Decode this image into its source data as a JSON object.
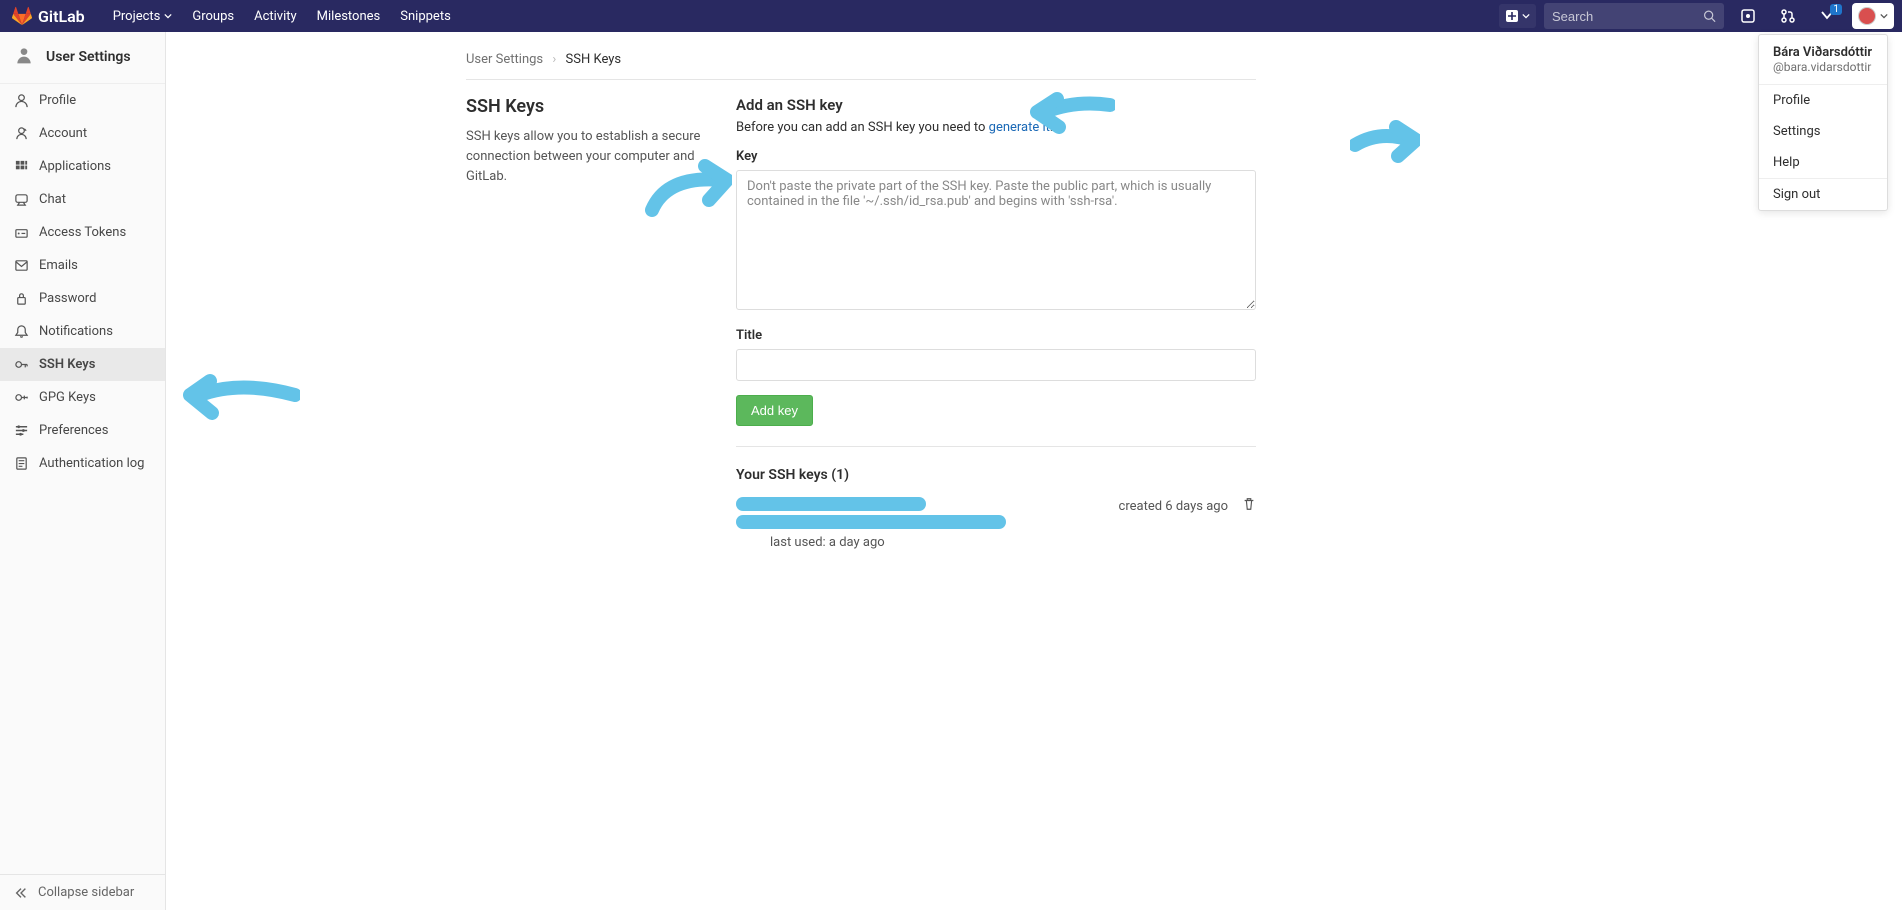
{
  "navbar": {
    "brand": "GitLab",
    "links": [
      "Projects",
      "Groups",
      "Activity",
      "Milestones",
      "Snippets"
    ],
    "search_placeholder": "Search",
    "todo_badge": "1"
  },
  "sidebar": {
    "title": "User Settings",
    "items": [
      {
        "label": "Profile"
      },
      {
        "label": "Account"
      },
      {
        "label": "Applications"
      },
      {
        "label": "Chat"
      },
      {
        "label": "Access Tokens"
      },
      {
        "label": "Emails"
      },
      {
        "label": "Password"
      },
      {
        "label": "Notifications"
      },
      {
        "label": "SSH Keys"
      },
      {
        "label": "GPG Keys"
      },
      {
        "label": "Preferences"
      },
      {
        "label": "Authentication log"
      }
    ],
    "active_index": 8,
    "collapse_label": "Collapse sidebar"
  },
  "breadcrumb": {
    "a": "User Settings",
    "b": "SSH Keys"
  },
  "section": {
    "title": "SSH Keys",
    "sub": "SSH keys allow you to establish a secure connection between your computer and GitLab."
  },
  "form": {
    "add_title": "Add an SSH key",
    "help_pre": "Before you can add an SSH key you need to ",
    "help_link": "generate it",
    "help_post": ".",
    "key_label": "Key",
    "key_placeholder": "Don't paste the private part of the SSH key. Paste the public part, which is usually contained in the file '~/.ssh/id_rsa.pub' and begins with 'ssh-rsa'.",
    "title_label": "Title",
    "submit_label": "Add key"
  },
  "keys": {
    "heading": "Your SSH keys (1)",
    "list": [
      {
        "created": "created 6 days ago",
        "last_used": "last used: a day ago"
      }
    ]
  },
  "user_dd": {
    "name": "Bára Viðarsdóttir",
    "handle": "@bara.vidarsdottir",
    "items_a": [
      "Profile",
      "Settings",
      "Help"
    ],
    "signout": "Sign out"
  }
}
